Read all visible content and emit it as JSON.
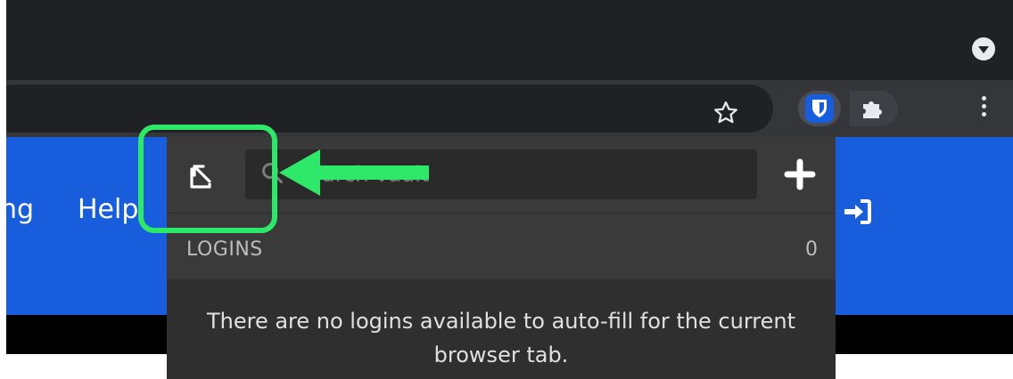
{
  "browser": {
    "icons": {
      "profile": "chevron-down-icon",
      "bookmark": "star-icon",
      "extension": "bitwarden-shield-icon",
      "extensions": "puzzle-icon",
      "menu": "kebab-menu-icon"
    }
  },
  "page": {
    "nav_partial": "ng",
    "nav_help": "Help",
    "colors": {
      "brand": "#175ddc"
    }
  },
  "popup": {
    "search": {
      "placeholder": "Search vault",
      "value": ""
    },
    "section": {
      "title": "LOGINS",
      "count": "0"
    },
    "empty_message": "There are no logins available to auto-fill for the current browser tab.",
    "icons": {
      "popout": "popout-icon",
      "search": "search-icon",
      "add": "plus-icon"
    }
  },
  "annotation": {
    "color": "#2ee86a",
    "icons": {
      "arrow": "arrow-left-icon"
    }
  }
}
